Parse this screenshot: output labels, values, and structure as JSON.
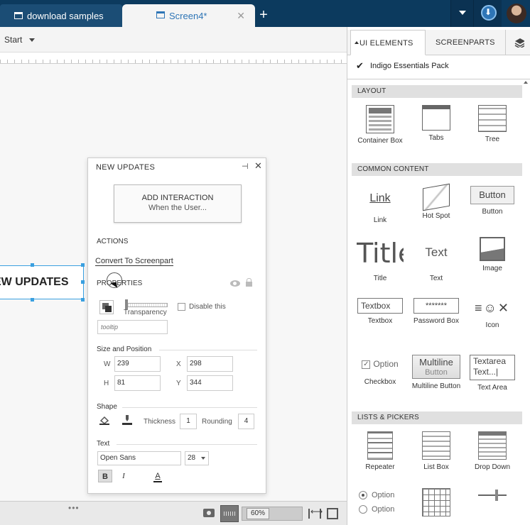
{
  "tabs": [
    {
      "label": "download samples",
      "active": false
    },
    {
      "label": "Screen4*",
      "active": true
    }
  ],
  "toolbar": {
    "scenario_label": "Start"
  },
  "canvas": {
    "selected_element_text": "EW UPDATES"
  },
  "props_panel": {
    "title": "NEW UPDATES",
    "add_interaction": {
      "line1": "ADD INTERACTION",
      "line2": "When the User..."
    },
    "actions_heading": "ACTIONS",
    "convert_link": "Convert To Screenpart",
    "properties_heading": "PROPERTIES",
    "transparency_label": "Transparency",
    "disable_label": "Disable this",
    "tooltip_placeholder": "tooltip",
    "size_heading": "Size and Position",
    "w_label": "W",
    "w_value": "239",
    "x_label": "X",
    "x_value": "298",
    "h_label": "H",
    "h_value": "81",
    "y_label": "Y",
    "y_value": "344",
    "shape_heading": "Shape",
    "thickness_label": "Thickness",
    "thickness_value": "1",
    "rounding_label": "Rounding",
    "rounding_value": "4",
    "text_heading": "Text",
    "font_value": "Open Sans",
    "font_size_value": "28",
    "bold_label": "B",
    "italic_label": "I",
    "color_label": "A"
  },
  "status_bar": {
    "zoom_label": "60%"
  },
  "right_panel": {
    "tab_ui": "UI ELEMENTS",
    "tab_screenparts": "SCREENPARTS",
    "pack": "Indigo Essentials Pack",
    "categories": [
      {
        "label": "LAYOUT",
        "items": [
          {
            "label": "Container Box",
            "icon": "container-box-icon"
          },
          {
            "label": "Tabs",
            "icon": "tabs-icon"
          },
          {
            "label": "Tree",
            "icon": "tree-icon"
          }
        ]
      },
      {
        "label": "COMMON CONTENT",
        "items": [
          {
            "label": "Link",
            "icon": "link-icon",
            "preview": "Link"
          },
          {
            "label": "Hot Spot",
            "icon": "hot-spot-icon"
          },
          {
            "label": "Button",
            "icon": "button-icon",
            "preview": "Button"
          },
          {
            "label": "Title",
            "icon": "title-icon",
            "preview": "Title"
          },
          {
            "label": "Text",
            "icon": "text-icon",
            "preview": "Text"
          },
          {
            "label": "Image",
            "icon": "image-icon"
          },
          {
            "label": "Textbox",
            "icon": "textbox-icon",
            "preview": "Textbox"
          },
          {
            "label": "Password Box",
            "icon": "password-box-icon",
            "preview": "*******"
          },
          {
            "label": "Icon",
            "icon": "icon-set-icon",
            "preview": "≡☺✕"
          },
          {
            "label": "Checkbox",
            "icon": "checkbox-icon",
            "preview": "Option"
          },
          {
            "label": "Multiline Button",
            "icon": "multiline-button-icon",
            "preview": "Multiline",
            "preview2": "Button"
          },
          {
            "label": "Text Area",
            "icon": "text-area-icon",
            "preview": "Textarea",
            "preview2": "Text...|"
          }
        ]
      },
      {
        "label": "LISTS & PICKERS",
        "items": [
          {
            "label": "Repeater",
            "icon": "repeater-icon"
          },
          {
            "label": "List Box",
            "icon": "list-box-icon"
          },
          {
            "label": "Drop Down",
            "icon": "drop-down-icon"
          },
          {
            "label": "",
            "icon": "radio-button-icon",
            "preview": "Option",
            "preview2": "Option"
          },
          {
            "label": "",
            "icon": "data-grid-icon"
          },
          {
            "label": "",
            "icon": "slider-icon"
          }
        ]
      }
    ]
  }
}
